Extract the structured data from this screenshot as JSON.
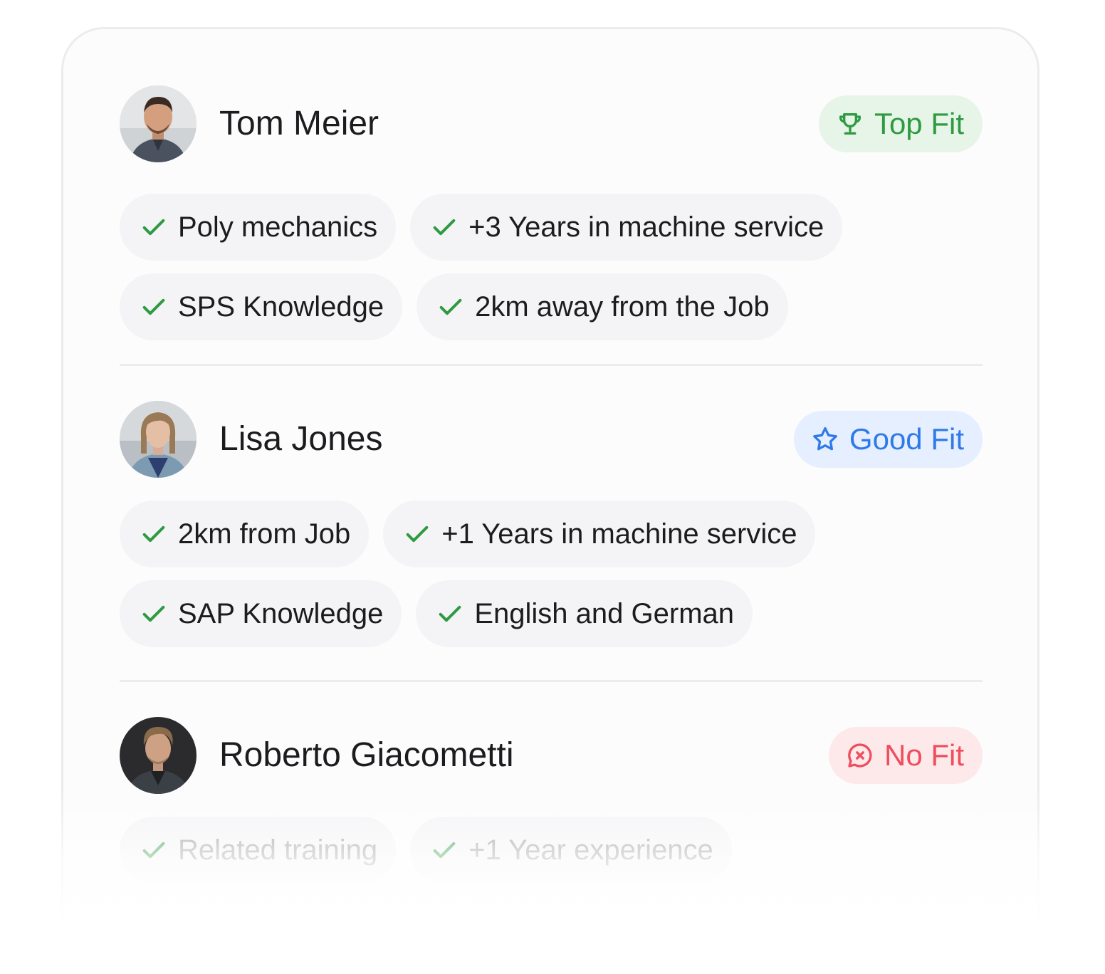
{
  "candidates": [
    {
      "name": "Tom Meier",
      "badge": {
        "label": "Top Fit",
        "icon": "trophy-icon",
        "color": "#2e9a41"
      },
      "tags_row1": [
        "Poly mechanics",
        "+3 Years in machine service"
      ],
      "tags_row2": [
        "SPS Knowledge",
        "2km away from the Job"
      ]
    },
    {
      "name": "Lisa Jones",
      "badge": {
        "label": "Good Fit",
        "icon": "star-icon",
        "color": "#2f7ae8"
      },
      "tags_row1": [
        "2km from Job",
        "+1 Years in machine service"
      ],
      "tags_row2": [
        "SAP Knowledge",
        "English and German"
      ]
    },
    {
      "name": "Roberto Giacometti",
      "badge": {
        "label": "No Fit",
        "icon": "message-x-icon",
        "color": "#ee4e5d"
      },
      "tags_row1": [
        "Related training",
        "+1 Year experience"
      ]
    }
  ],
  "colors": {
    "check": "#2e9a41",
    "tag_background": "#f4f4f6",
    "card_border": "#ececef"
  }
}
